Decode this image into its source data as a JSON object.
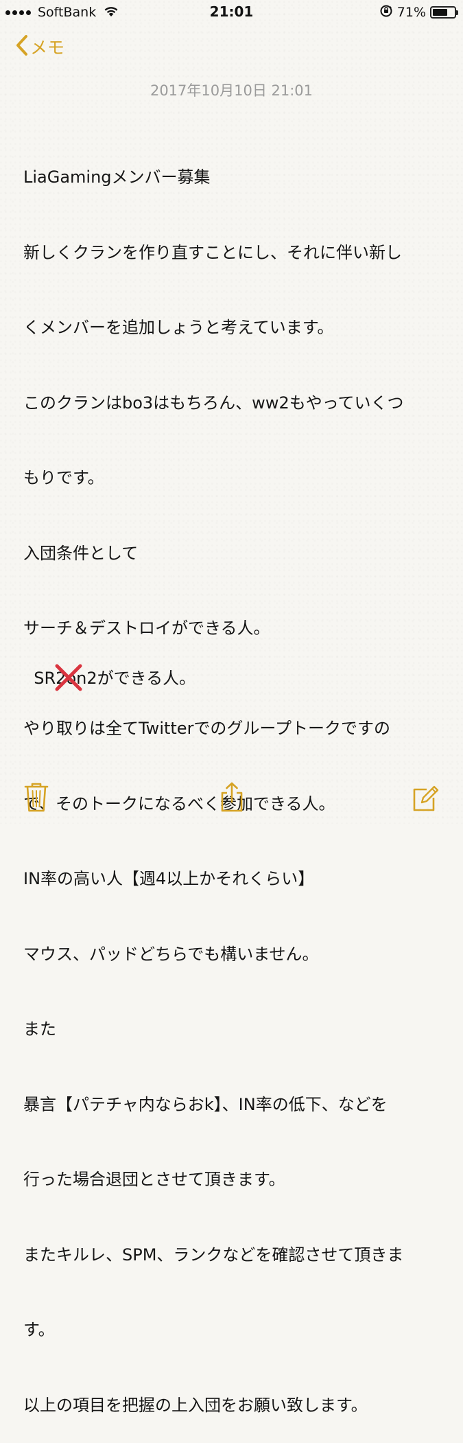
{
  "status_bar": {
    "carrier": "SoftBank",
    "time": "21:01",
    "battery_percent": "71%",
    "battery_level": 0.71
  },
  "nav": {
    "back_label": "メモ"
  },
  "note": {
    "date": "2017年10月10日 21:01",
    "lines": [
      "LiaGamingメンバー募集",
      "新しくクランを作り直すことにし、それに伴い新し",
      "くメンバーを追加しょうと考えています。",
      "このクランはbo3はもちろん、ww2もやっていくつ",
      "もりです。",
      "入団条件として",
      "サーチ＆デストロイができる人。",
      "SR2on2ができる人。",
      "やり取りは全てTwitterでのグループトークですの",
      "で、そのトークになるべく参加できる人。",
      "IN率の高い人【週4以上かそれくらい】",
      "マウス、パッドどちらでも構いません。",
      "また",
      "暴言【パテチャ内ならおk】、IN率の低下、などを",
      "行った場合退団とさせて頂きます。",
      "またキルレ、SPM、ランクなどを確認させて頂きま",
      "す。",
      "以上の項目を把握の上入団をお願い致します。"
    ]
  },
  "colors": {
    "accent": "#d6a325",
    "strike_mark": "#d9343f",
    "date_text": "#9a9a9a"
  },
  "toolbar": {
    "icons": [
      "trash-icon",
      "share-icon",
      "compose-icon"
    ]
  }
}
